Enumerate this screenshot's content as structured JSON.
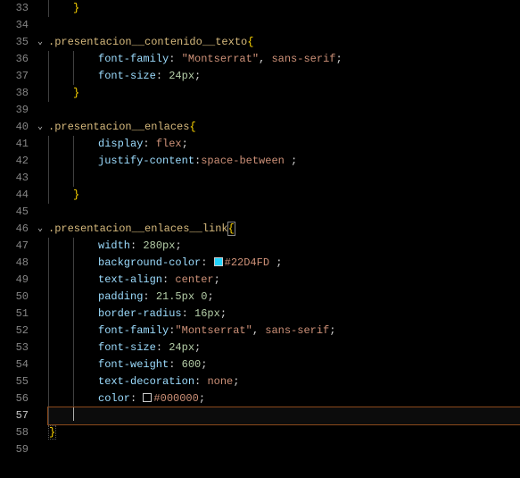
{
  "lines": [
    {
      "num": "33",
      "fold": "",
      "indent": 1,
      "tokens": [
        {
          "t": "}",
          "c": "tok-brace"
        }
      ]
    },
    {
      "num": "34",
      "fold": "",
      "indent": 0,
      "tokens": []
    },
    {
      "num": "35",
      "fold": "⌄",
      "indent": 0,
      "tokens": [
        {
          "t": ".presentacion__contenido__texto",
          "c": "tok-selector"
        },
        {
          "t": "{",
          "c": "tok-brace"
        }
      ]
    },
    {
      "num": "36",
      "fold": "",
      "indent": 2,
      "tokens": [
        {
          "t": "font-family",
          "c": "tok-prop"
        },
        {
          "t": ": ",
          "c": "tok-colon"
        },
        {
          "t": "\"Montserrat\"",
          "c": "tok-string"
        },
        {
          "t": ", ",
          "c": "tok-punct"
        },
        {
          "t": "sans-serif",
          "c": "tok-value"
        },
        {
          "t": ";",
          "c": "tok-punct"
        }
      ]
    },
    {
      "num": "37",
      "fold": "",
      "indent": 2,
      "tokens": [
        {
          "t": "font-size",
          "c": "tok-prop"
        },
        {
          "t": ": ",
          "c": "tok-colon"
        },
        {
          "t": "24px",
          "c": "tok-num"
        },
        {
          "t": ";",
          "c": "tok-punct"
        }
      ]
    },
    {
      "num": "38",
      "fold": "",
      "indent": 1,
      "tokens": [
        {
          "t": "}",
          "c": "tok-brace"
        }
      ]
    },
    {
      "num": "39",
      "fold": "",
      "indent": 0,
      "tokens": []
    },
    {
      "num": "40",
      "fold": "⌄",
      "indent": 0,
      "tokens": [
        {
          "t": ".presentacion__enlaces",
          "c": "tok-selector"
        },
        {
          "t": "{",
          "c": "tok-brace"
        }
      ]
    },
    {
      "num": "41",
      "fold": "",
      "indent": 2,
      "tokens": [
        {
          "t": "display",
          "c": "tok-prop"
        },
        {
          "t": ": ",
          "c": "tok-colon"
        },
        {
          "t": "flex",
          "c": "tok-value"
        },
        {
          "t": ";",
          "c": "tok-punct"
        }
      ]
    },
    {
      "num": "42",
      "fold": "",
      "indent": 2,
      "tokens": [
        {
          "t": "justify-content",
          "c": "tok-prop"
        },
        {
          "t": ":",
          "c": "tok-colon"
        },
        {
          "t": "space-between",
          "c": "tok-value"
        },
        {
          "t": " ;",
          "c": "tok-punct"
        }
      ]
    },
    {
      "num": "43",
      "fold": "",
      "indent": 2,
      "tokens": []
    },
    {
      "num": "44",
      "fold": "",
      "indent": 1,
      "tokens": [
        {
          "t": "}",
          "c": "tok-brace"
        }
      ]
    },
    {
      "num": "45",
      "fold": "",
      "indent": 0,
      "tokens": []
    },
    {
      "num": "46",
      "fold": "⌄",
      "indent": 0,
      "tokens": [
        {
          "t": ".presentacion__enlaces__link",
          "c": "tok-selector"
        },
        {
          "t": "{",
          "c": "tok-brace bracket-match"
        }
      ]
    },
    {
      "num": "47",
      "fold": "",
      "indent": 2,
      "tokens": [
        {
          "t": "width",
          "c": "tok-prop"
        },
        {
          "t": ": ",
          "c": "tok-colon"
        },
        {
          "t": "280px",
          "c": "tok-num"
        },
        {
          "t": ";",
          "c": "tok-punct"
        }
      ]
    },
    {
      "num": "48",
      "fold": "",
      "indent": 2,
      "tokens": [
        {
          "t": "background-color",
          "c": "tok-prop"
        },
        {
          "t": ": ",
          "c": "tok-colon"
        },
        {
          "swatch": "#22D4FD"
        },
        {
          "t": "#22D4FD",
          "c": "tok-value"
        },
        {
          "t": " ;",
          "c": "tok-punct"
        }
      ]
    },
    {
      "num": "49",
      "fold": "",
      "indent": 2,
      "tokens": [
        {
          "t": "text-align",
          "c": "tok-prop"
        },
        {
          "t": ": ",
          "c": "tok-colon"
        },
        {
          "t": "center",
          "c": "tok-value"
        },
        {
          "t": ";",
          "c": "tok-punct"
        }
      ]
    },
    {
      "num": "50",
      "fold": "",
      "indent": 2,
      "tokens": [
        {
          "t": "padding",
          "c": "tok-prop"
        },
        {
          "t": ": ",
          "c": "tok-colon"
        },
        {
          "t": "21.5px",
          "c": "tok-num"
        },
        {
          "t": " ",
          "c": "tok-punct"
        },
        {
          "t": "0",
          "c": "tok-num"
        },
        {
          "t": ";",
          "c": "tok-punct"
        }
      ]
    },
    {
      "num": "51",
      "fold": "",
      "indent": 2,
      "tokens": [
        {
          "t": "border-radius",
          "c": "tok-prop"
        },
        {
          "t": ": ",
          "c": "tok-colon"
        },
        {
          "t": "16px",
          "c": "tok-num"
        },
        {
          "t": ";",
          "c": "tok-punct"
        }
      ]
    },
    {
      "num": "52",
      "fold": "",
      "indent": 2,
      "tokens": [
        {
          "t": "font-family",
          "c": "tok-prop"
        },
        {
          "t": ":",
          "c": "tok-colon"
        },
        {
          "t": "\"Montserrat\"",
          "c": "tok-string"
        },
        {
          "t": ", ",
          "c": "tok-punct"
        },
        {
          "t": "sans-serif",
          "c": "tok-value"
        },
        {
          "t": ";",
          "c": "tok-punct"
        }
      ]
    },
    {
      "num": "53",
      "fold": "",
      "indent": 2,
      "tokens": [
        {
          "t": "font-size",
          "c": "tok-prop"
        },
        {
          "t": ": ",
          "c": "tok-colon"
        },
        {
          "t": "24px",
          "c": "tok-num"
        },
        {
          "t": ";",
          "c": "tok-punct"
        }
      ]
    },
    {
      "num": "54",
      "fold": "",
      "indent": 2,
      "tokens": [
        {
          "t": "font-weight",
          "c": "tok-prop"
        },
        {
          "t": ": ",
          "c": "tok-colon"
        },
        {
          "t": "600",
          "c": "tok-num"
        },
        {
          "t": ";",
          "c": "tok-punct"
        }
      ]
    },
    {
      "num": "55",
      "fold": "",
      "indent": 2,
      "tokens": [
        {
          "t": "text-decoration",
          "c": "tok-prop"
        },
        {
          "t": ": ",
          "c": "tok-colon"
        },
        {
          "t": "none",
          "c": "tok-value"
        },
        {
          "t": ";",
          "c": "tok-punct"
        }
      ]
    },
    {
      "num": "56",
      "fold": "",
      "indent": 2,
      "tokens": [
        {
          "t": "color",
          "c": "tok-prop"
        },
        {
          "t": ": ",
          "c": "tok-colon"
        },
        {
          "swatch": "#000000"
        },
        {
          "t": "#000000",
          "c": "tok-value"
        },
        {
          "t": ";",
          "c": "tok-punct"
        }
      ]
    },
    {
      "num": "57",
      "fold": "",
      "indent": 1,
      "current": true,
      "tokens": [
        {
          "cursor": true
        }
      ]
    },
    {
      "num": "58",
      "fold": "",
      "indent": 0,
      "tokens": [
        {
          "t": "}",
          "c": "tok-brace close-brace-hl"
        }
      ]
    },
    {
      "num": "59",
      "fold": "",
      "indent": 0,
      "tokens": []
    }
  ],
  "indentSize": 4
}
